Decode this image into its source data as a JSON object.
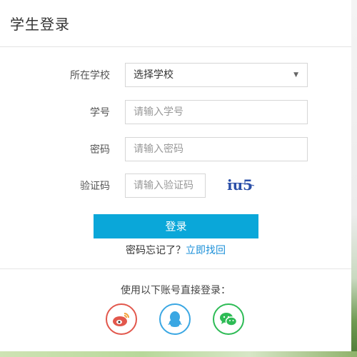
{
  "header": {
    "title": "学生登录"
  },
  "form": {
    "school": {
      "label": "所在学校",
      "value": "选择学校"
    },
    "student_id": {
      "label": "学号",
      "placeholder": "请输入学号"
    },
    "password": {
      "label": "密码",
      "placeholder": "请输入密码"
    },
    "captcha": {
      "label": "验证码",
      "placeholder": "请输入验证码",
      "image_text": "iu5"
    }
  },
  "login_button": "登录",
  "forgot": {
    "text": "密码忘记了？",
    "link": "立即找回"
  },
  "social": {
    "title": "使用以下账号直接登录：",
    "providers": [
      {
        "name": "weibo",
        "icon": "weibo-icon",
        "color": "#e2574c"
      },
      {
        "name": "qq",
        "icon": "qq-icon",
        "color": "#3aa7e3"
      },
      {
        "name": "wechat",
        "icon": "wechat-icon",
        "color": "#2dbb55"
      }
    ]
  },
  "colors": {
    "primary": "#0aa7d9",
    "link": "#1a8fd8"
  }
}
